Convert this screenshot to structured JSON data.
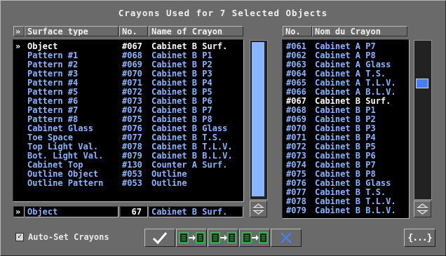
{
  "title": "Crayons Used for 7 Selected Objects",
  "left_list": {
    "col_headers": {
      "marker": "»",
      "surface": "Surface type",
      "no": "No.",
      "name": "Name of Crayon"
    },
    "rows": [
      {
        "marker": "»",
        "surface": "Object",
        "no": "#067",
        "name": "Cabinet B Surf.",
        "selected": true
      },
      {
        "marker": "",
        "surface": "Pattern #1",
        "no": "#068",
        "name": "Cabinet B P1"
      },
      {
        "marker": "",
        "surface": "Pattern #2",
        "no": "#069",
        "name": "Cabinet B P2"
      },
      {
        "marker": "",
        "surface": "Pattern #3",
        "no": "#070",
        "name": "Cabinet B P3"
      },
      {
        "marker": "",
        "surface": "Pattern #4",
        "no": "#071",
        "name": "Cabinet B P4"
      },
      {
        "marker": "",
        "surface": "Pattern #5",
        "no": "#072",
        "name": "Cabinet B P5"
      },
      {
        "marker": "",
        "surface": "Pattern #6",
        "no": "#073",
        "name": "Cabinet B P6"
      },
      {
        "marker": "",
        "surface": "Pattern #7",
        "no": "#074",
        "name": "Cabinet B P7"
      },
      {
        "marker": "",
        "surface": "Pattern #8",
        "no": "#075",
        "name": "Cabinet B P8"
      },
      {
        "marker": "",
        "surface": "Cabinet Glass",
        "no": "#076",
        "name": "Cabinet B Glass"
      },
      {
        "marker": "",
        "surface": "Toe Space",
        "no": "#077",
        "name": "Cabinet B T.S."
      },
      {
        "marker": "",
        "surface": "Top Light Val.",
        "no": "#078",
        "name": "Cabinet B T.L.V."
      },
      {
        "marker": "",
        "surface": "Bot. Light Val.",
        "no": "#079",
        "name": "Cabinet B B.L.V."
      },
      {
        "marker": "",
        "surface": "Cabinet Top",
        "no": "#130",
        "name": "Counter A Surf."
      },
      {
        "marker": "",
        "surface": "Outline Object",
        "no": "#053",
        "name": "Outline"
      },
      {
        "marker": "",
        "surface": "Outline Pattern",
        "no": "#053",
        "name": "Outline"
      }
    ],
    "scroll_fraction": 1.0
  },
  "edit_row": {
    "marker": "»",
    "surface": "Object",
    "no": "67",
    "name": "Cabinet B Surf."
  },
  "right_list": {
    "col_headers": {
      "no": "No.",
      "name": "Nom du Crayon"
    },
    "rows": [
      {
        "no": "#061",
        "name": "Cabinet A P7"
      },
      {
        "no": "#062",
        "name": "Cabinet A P8"
      },
      {
        "no": "#063",
        "name": "Cabinet A Glass"
      },
      {
        "no": "#064",
        "name": "Cabinet A T.S."
      },
      {
        "no": "#065",
        "name": "Cabinet A T.L.V."
      },
      {
        "no": "#066",
        "name": "Cabinet A B.L.V."
      },
      {
        "no": "#067",
        "name": "Cabinet B Surf.",
        "current": true
      },
      {
        "no": "#068",
        "name": "Cabinet B P1"
      },
      {
        "no": "#069",
        "name": "Cabinet B P2"
      },
      {
        "no": "#070",
        "name": "Cabinet B P3"
      },
      {
        "no": "#071",
        "name": "Cabinet B P4"
      },
      {
        "no": "#072",
        "name": "Cabinet B P5"
      },
      {
        "no": "#073",
        "name": "Cabinet B P6"
      },
      {
        "no": "#074",
        "name": "Cabinet B P7"
      },
      {
        "no": "#075",
        "name": "Cabinet B P8"
      },
      {
        "no": "#076",
        "name": "Cabinet B Glass"
      },
      {
        "no": "#077",
        "name": "Cabinet B T.S."
      },
      {
        "no": "#078",
        "name": "Cabinet B T.L.V."
      },
      {
        "no": "#079",
        "name": "Cabinet B B.L.V."
      }
    ]
  },
  "auto_set": {
    "label": "Auto-Set Crayons",
    "checked": true,
    "check_glyph": "✓"
  },
  "buttons": {
    "ok_icon": "checkmark-icon",
    "copy_icons": [
      "copy-crayon-icon",
      "copy-crayon-icon",
      "copy-crayon-icon"
    ],
    "cancel_icon": "cancel-x-icon",
    "brace": "{...}"
  },
  "colors": {
    "list_text": "#8ab4ff",
    "highlight_text": "#ffffff",
    "panel": "#6a6a6a",
    "list_bg": "#000000",
    "ok_check": "#ffffff",
    "cancel_x": "#4a7ef0",
    "copy_icon_green": "#3cc850"
  }
}
